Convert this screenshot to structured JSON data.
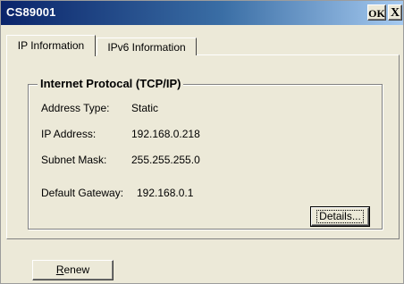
{
  "window": {
    "title": "CS89001",
    "ok_label": "OK",
    "close_label": "X"
  },
  "tabs": [
    {
      "label": "IP Information",
      "selected": true
    },
    {
      "label": "IPv6 Information",
      "selected": false
    }
  ],
  "group": {
    "title": "Internet Protocal (TCP/IP)",
    "fields": [
      {
        "label": "Address Type:",
        "value": "Static"
      },
      {
        "label": "IP Address:",
        "value": "192.168.0.218"
      },
      {
        "label": "Subnet Mask:",
        "value": "255.255.255.0"
      },
      {
        "label": "Default Gateway:",
        "value": "192.168.0.1"
      }
    ]
  },
  "buttons": {
    "details_label": "Details...",
    "renew_first": "R",
    "renew_rest": "enew"
  },
  "colors": {
    "title_bar_start": "#0a246a",
    "title_bar_end": "#a6caf0",
    "dialog_face": "#ece9d8"
  }
}
